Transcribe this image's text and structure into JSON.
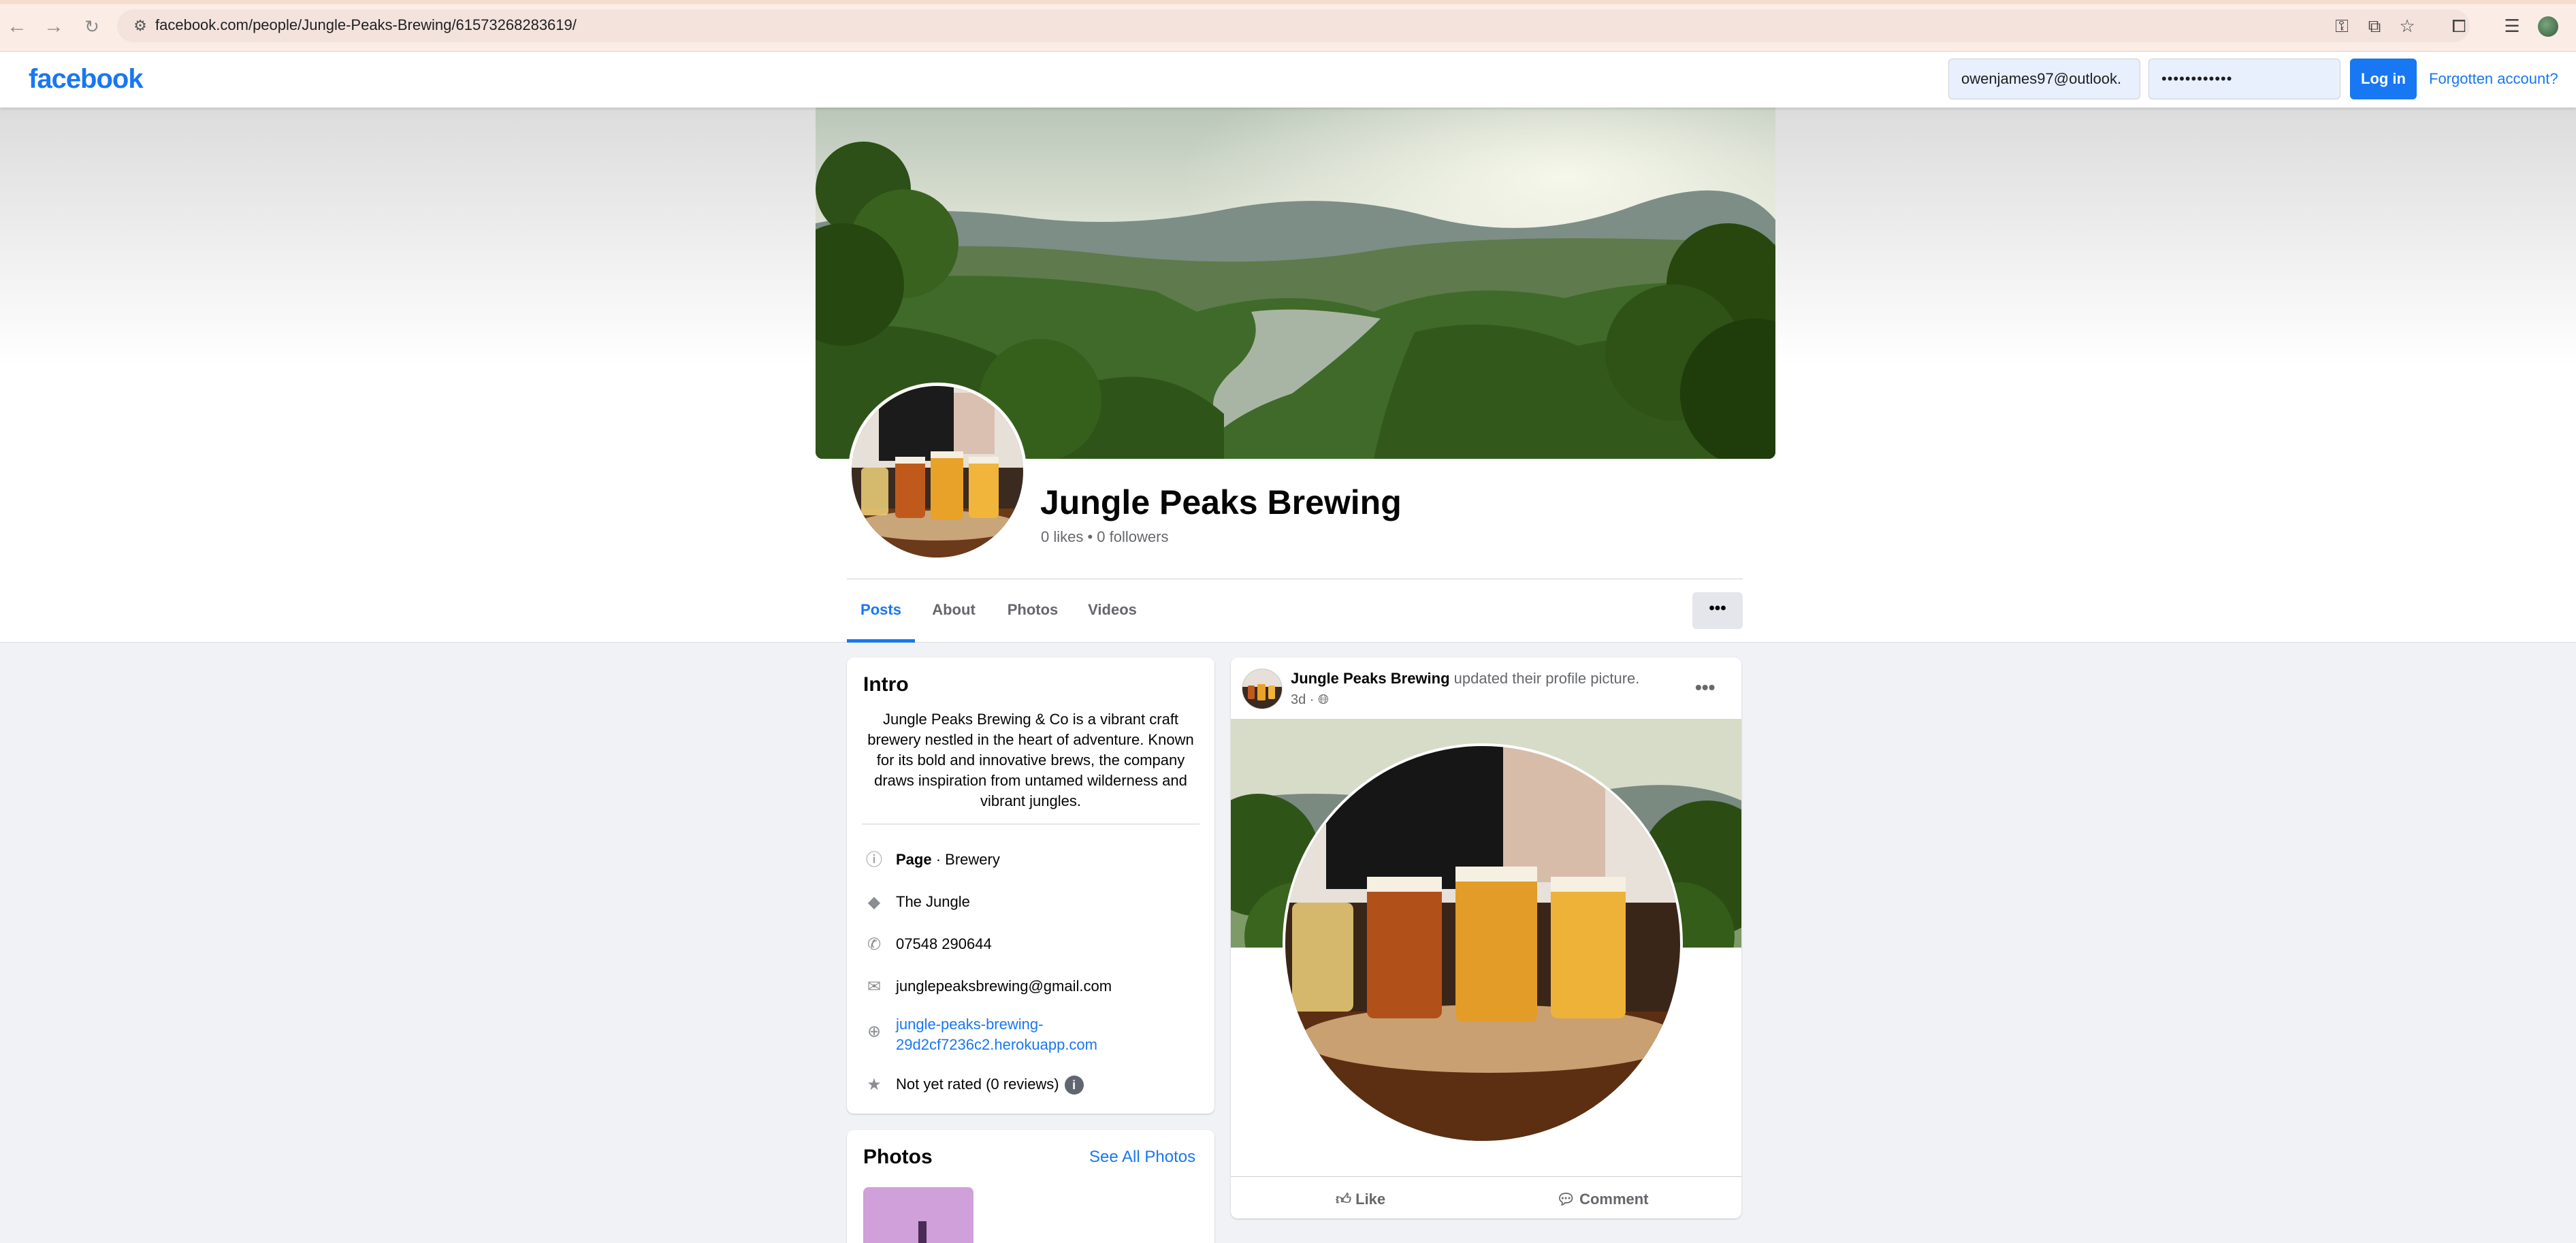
{
  "browser": {
    "url": "facebook.com/people/Jungle-Peaks-Brewing/61573268283619/"
  },
  "header": {
    "logo": "facebook",
    "email_value": "owenjames97@outlook.",
    "password_value": "••••••••••••",
    "login_label": "Log in",
    "forgot_label": "Forgotten account?",
    "brand_color": "#1877f2"
  },
  "profile": {
    "name": "Jungle Peaks Brewing",
    "stats": "0 likes • 0 followers",
    "tabs": [
      {
        "label": "Posts",
        "active": true
      },
      {
        "label": "About",
        "active": false
      },
      {
        "label": "Photos",
        "active": false
      },
      {
        "label": "Videos",
        "active": false
      }
    ],
    "more_label": "•••"
  },
  "intro": {
    "title": "Intro",
    "bio": "Jungle Peaks Brewing & Co is a vibrant craft brewery nestled in the heart of adventure. Known for its bold and innovative brews, the company draws inspiration from untamed wilderness and vibrant jungles.",
    "category_bold": "Page",
    "category_rest": " · Brewery",
    "location": "The Jungle",
    "phone": "07548 290644",
    "email": "junglepeaksbrewing@gmail.com",
    "website_line1": "jungle-peaks-brewing-",
    "website_line2": "29d2cf7236c2.herokuapp.com",
    "rating": "Not yet rated (0 reviews)"
  },
  "photos": {
    "title": "Photos",
    "see_all": "See All Photos"
  },
  "post": {
    "author": "Jungle Peaks Brewing",
    "action": " updated their profile picture.",
    "time": "3d ·",
    "like_label": "Like",
    "comment_label": "Comment"
  }
}
